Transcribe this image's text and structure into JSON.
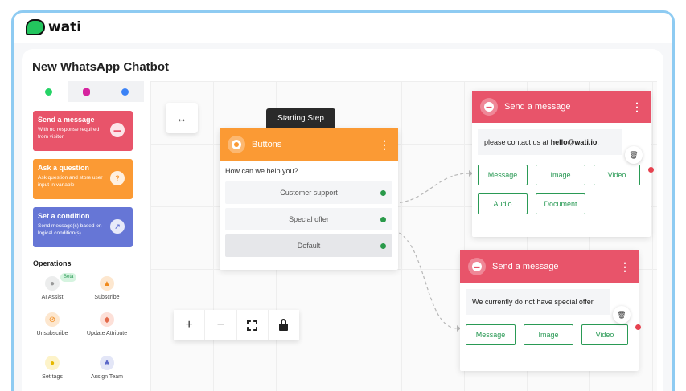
{
  "app": {
    "logo_text": "wati"
  },
  "page": {
    "title": "New WhatsApp Chatbot"
  },
  "sidebar": {
    "tabs": [
      {
        "icon": "whatsapp-icon",
        "color": "#25D366"
      },
      {
        "icon": "instagram-icon",
        "color": "#d6249f"
      },
      {
        "icon": "messenger-icon",
        "color": "#3b82f6"
      }
    ],
    "palette": [
      {
        "title": "Send a message",
        "desc": "With no response required from visitor",
        "color": "#e8546a",
        "icon": "chat-icon"
      },
      {
        "title": "Ask a question",
        "desc": "Ask question and store user input in variable",
        "color": "#fb9a34",
        "icon": "question-icon"
      },
      {
        "title": "Set a condition",
        "desc": "Send message(s) based on logical condition(s)",
        "color": "#6676d6",
        "icon": "branch-icon"
      }
    ],
    "operations_title": "Operations",
    "operations": [
      {
        "label": "AI Assist",
        "icon": "ai-icon",
        "badge": "Beta"
      },
      {
        "label": "Subscribe",
        "icon": "bell-icon"
      },
      {
        "label": "Unsubscribe",
        "icon": "bell-off-icon"
      },
      {
        "label": "Update Attribute",
        "icon": "tag-icon"
      },
      {
        "label": "Set tags",
        "icon": "bulb-icon"
      },
      {
        "label": "Assign Team",
        "icon": "team-icon"
      }
    ]
  },
  "canvas": {
    "start_tag": "Starting Step",
    "buttons_node": {
      "title": "Buttons",
      "question": "How can we help you?",
      "options": [
        "Customer support",
        "Special offer",
        "Default"
      ],
      "color": "#fb9a34"
    },
    "message_node_1": {
      "title": "Send a message",
      "message_prefix": "please contact us at ",
      "message_bold": "hello@wati.io",
      "message_suffix": ".",
      "chips": [
        "Message",
        "Image",
        "Video",
        "Audio",
        "Document"
      ],
      "color": "#e8546a"
    },
    "message_node_2": {
      "title": "Send a message",
      "message": "We currently do not have special offer",
      "chips": [
        "Message",
        "Image",
        "Video"
      ],
      "color": "#e8546a"
    },
    "toolbar": {
      "zoom_in": "+",
      "zoom_out": "−"
    }
  }
}
